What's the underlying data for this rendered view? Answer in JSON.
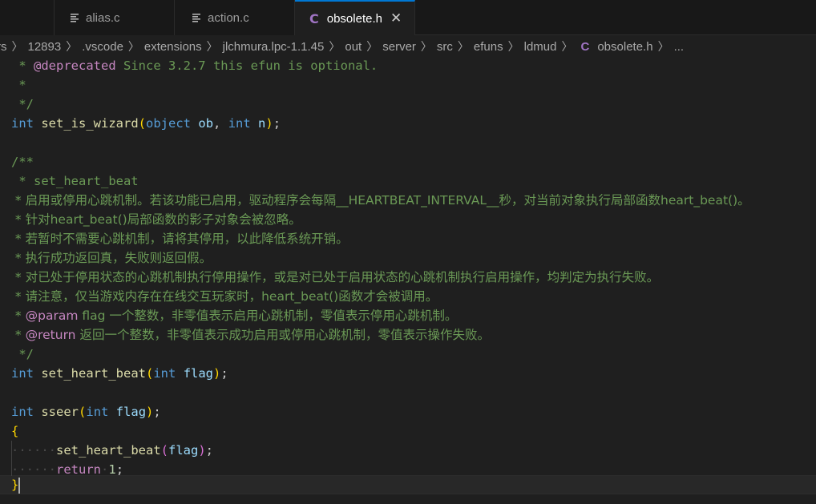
{
  "tabs": [
    {
      "label": "",
      "icon": "lines-icon"
    },
    {
      "label": "alias.c",
      "icon": "lines-icon"
    },
    {
      "label": "action.c",
      "icon": "lines-icon"
    },
    {
      "label": "obsolete.h",
      "icon": "c-file-icon",
      "active": true
    }
  ],
  "breadcrumb": {
    "items": [
      "rs",
      "12893",
      ".vscode",
      "extensions",
      "jlchmura.lpc-1.1.45",
      "out",
      "server",
      "src",
      "efuns",
      "ldmud"
    ],
    "file": "obsolete.h",
    "more": "..."
  },
  "code": {
    "l1_star": " * ",
    "l1_tag": "@deprecated",
    "l1_text": " Since 3.2.7 this efun is optional.",
    "l2": " *",
    "l3": " */",
    "l4_kw": "int",
    "l4_fn": "set_is_wizard",
    "l4_p1": "object",
    "l4_a1": "ob",
    "l4_p2": "int",
    "l4_a2": "n",
    "l6": "/**",
    "l7": " * set_heart_beat",
    "l8": " * 启用或停用心跳机制。若该功能已启用，驱动程序会每隔__HEARTBEAT_INTERVAL__秒，对当前对象执行局部函数heart_beat()。",
    "l9": " * 针对heart_beat()局部函数的影子对象会被忽略。",
    "l10": " * 若暂时不需要心跳机制，请将其停用，以此降低系统开销。",
    "l11": " * 执行成功返回真，失败则返回假。",
    "l12": " * 对已处于停用状态的心跳机制执行停用操作，或是对已处于启用状态的心跳机制执行启用操作，均判定为执行失败。",
    "l13": " * 请注意，仅当游戏内存在在线交互玩家时，heart_beat()函数才会被调用。",
    "l14_tag": "@param",
    "l14_text": " flag 一个整数，非零值表示启用心跳机制，零值表示停用心跳机制。",
    "l15_tag": "@return",
    "l15_text": " 返回一个整数，非零值表示成功启用或停用心跳机制，零值表示操作失败。",
    "l16": " */",
    "l17_fn": "set_heart_beat",
    "l17_arg": "flag",
    "l19_fn": "sseer",
    "l19_arg": "flag",
    "l21_fn": "set_heart_beat",
    "l21_arg": "flag",
    "l22_kw": "return",
    "l22_num": "1"
  },
  "colors": {
    "accent": "#0078d4",
    "keyword": "#569cd6",
    "function": "#dcdcaa",
    "param": "#9cdcfe",
    "comment": "#6a9955",
    "tag": "#569cd6"
  }
}
